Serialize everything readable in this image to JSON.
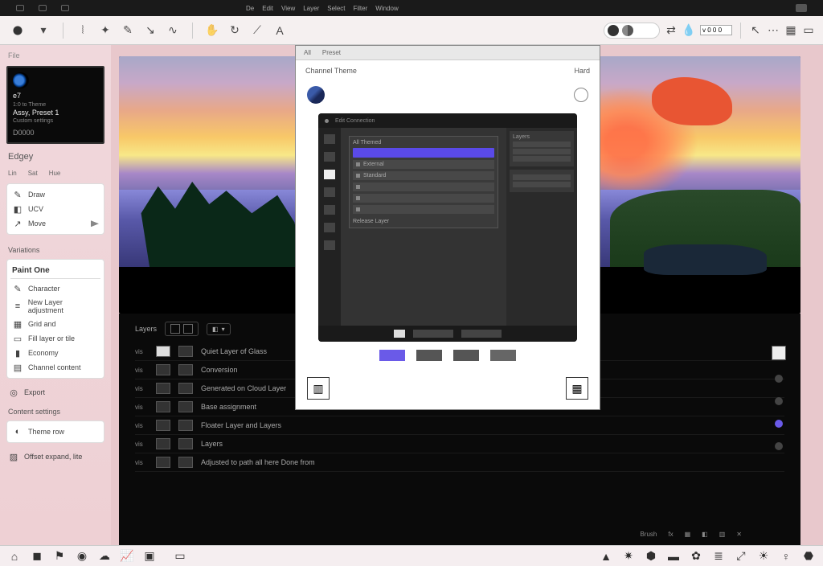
{
  "osbar": {
    "menu": [
      "De",
      "Edit",
      "View",
      "Layer",
      "Select",
      "Filter",
      "Window"
    ]
  },
  "toolbar": {
    "value": "v 0 0 0"
  },
  "sidebar": {
    "tab": "File",
    "card": {
      "title": "e7",
      "line1": "1:0 to Theme",
      "line2": "Assy, Preset 1",
      "line3": "Custom settings",
      "line4": "D0000"
    },
    "mode_label": "Edgey",
    "modes": [
      "Lin",
      "Sat",
      "Hue"
    ],
    "group1": [
      {
        "ic": "✎",
        "t": "Draw"
      },
      {
        "ic": "◧",
        "t": "UCV"
      },
      {
        "ic": "↗",
        "t": "Move"
      }
    ],
    "section": "Variations",
    "heading": "Paint One",
    "group2": [
      {
        "ic": "✎",
        "t": "Character"
      },
      {
        "ic": "≡",
        "t": "New Layer adjustment"
      },
      {
        "ic": "▦",
        "t": "Grid and"
      },
      {
        "ic": "▭",
        "t": "Fill layer or tile"
      },
      {
        "ic": "▮",
        "t": "Economy"
      },
      {
        "ic": "▤",
        "t": "Channel content"
      }
    ],
    "export": "Export",
    "content_hdr": "Content settings",
    "content_items": [
      {
        "ic": "◐",
        "t": "Theme row"
      }
    ],
    "bottom": "Offset expand, lite"
  },
  "layers": {
    "label": "Layers",
    "rows": [
      {
        "v": "vis",
        "n": "Quiet Layer of Glass"
      },
      {
        "v": "vis",
        "n": "Conversion"
      },
      {
        "v": "vis",
        "n": "Generated on Cloud Layer"
      },
      {
        "v": "vis",
        "n": "Base assignment"
      },
      {
        "v": "vis",
        "n": "Floater Layer and Layers"
      },
      {
        "v": "vis",
        "n": "Layers"
      },
      {
        "v": "vis",
        "n": "Adjusted to path all here Done from"
      }
    ],
    "btm": [
      "Brush",
      "fx",
      "▦",
      "◧",
      "▥",
      "✕"
    ]
  },
  "dialog": {
    "tabs": [
      "All",
      "Preset"
    ],
    "hdr_l": "Channel Theme",
    "hdr_r": "Hard",
    "preview": {
      "top": "Edit Connection",
      "panel_title": "All Themed",
      "rows": [
        "External",
        "Standard",
        "",
        "",
        ""
      ],
      "foot": "Release Layer",
      "right_title": "Layers"
    },
    "swatches": [
      "#6a5ae8",
      "#555",
      "#555",
      "#666"
    ]
  }
}
